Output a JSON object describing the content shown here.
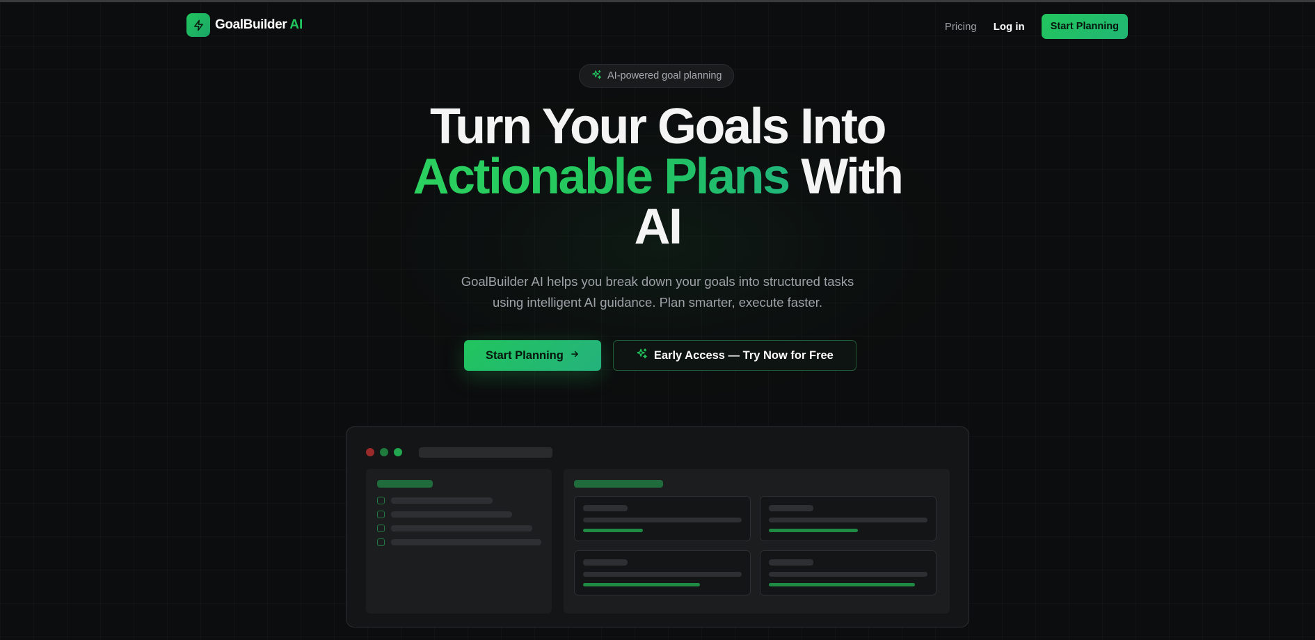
{
  "brand": {
    "name": "GoalBuilder",
    "accent": "AI",
    "logo_icon": "lightning-bolt-icon"
  },
  "nav": {
    "pricing": "Pricing",
    "login": "Log in",
    "cta": "Start Planning"
  },
  "hero": {
    "badge_icon": "sparkles-icon",
    "badge": "AI-powered goal planning",
    "headline_part1": "Turn Your Goals Into",
    "headline_highlight": "Actionable Plans",
    "headline_part2": "With",
    "headline_part3": "AI",
    "subtitle": "GoalBuilder AI helps you break down your goals into structured tasks using intelligent AI guidance. Plan smarter, execute faster.",
    "primary_button": "Start Planning",
    "primary_button_icon": "arrow-right-icon",
    "secondary_button": "Early Access — Try Now for Free",
    "secondary_button_icon": "sparkles-icon"
  },
  "mockup": {
    "window_dots": [
      "#9b2a2a",
      "#1f7a3e",
      "#22a64f"
    ],
    "checklist_items": 4,
    "cards": 4
  },
  "colors": {
    "background": "#0c0d0e",
    "accent": "#22c55e",
    "text": "#f4f4f4",
    "muted": "#9ea1a6"
  }
}
